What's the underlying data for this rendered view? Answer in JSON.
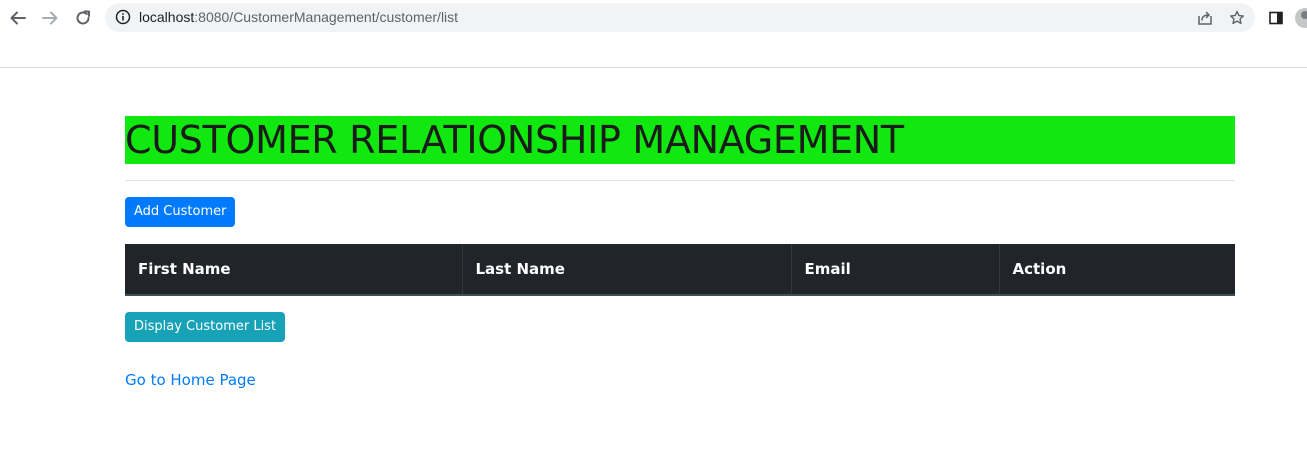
{
  "browser": {
    "url_host": "localhost",
    "url_rest": ":8080/CustomerManagement/customer/list"
  },
  "page": {
    "title": "CUSTOMER RELATIONSHIP MANAGEMENT",
    "add_button": "Add Customer",
    "table": {
      "columns": [
        "First Name",
        "Last Name",
        "Email",
        "Action"
      ]
    },
    "display_button": "Display Customer List",
    "home_link": "Go to Home Page"
  },
  "colors": {
    "title_bg": "#10e810",
    "primary": "#007bff",
    "info": "#17a2b8",
    "table_head": "#212529"
  },
  "icons": [
    "back-icon",
    "forward-icon",
    "reload-icon",
    "info-icon",
    "share-icon",
    "star-icon",
    "side-panel-icon",
    "profile-icon"
  ]
}
